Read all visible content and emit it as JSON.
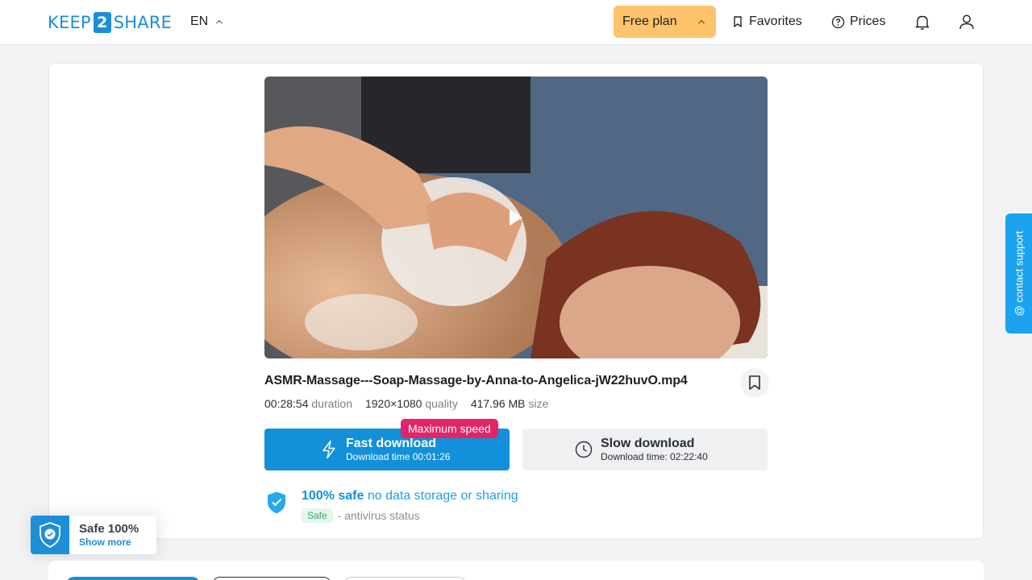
{
  "header": {
    "logo_left": "KEEP",
    "logo_mid": "2",
    "logo_right": "SHARE",
    "language": "EN",
    "free_plan": "Free plan",
    "favorites": "Favorites",
    "prices": "Prices"
  },
  "file": {
    "name": "ASMR-Massage---Soap-Massage-by-Anna-to-Angelica-jW22huvO.mp4",
    "duration_value": "00:28:54",
    "duration_label": "duration",
    "quality_value": "1920×1080",
    "quality_label": "quality",
    "size_value": "417.96 MB",
    "size_label": "size"
  },
  "download": {
    "badge": "Maximum speed",
    "fast_title": "Fast download",
    "fast_sub": "Download time 00:01:26",
    "slow_title": "Slow download",
    "slow_sub": "Download time: 02:22:40"
  },
  "safety": {
    "strong": "100% safe",
    "rest": "no data storage or sharing",
    "badge": "Safe",
    "status": "- antivirus status"
  },
  "support": {
    "label": "@ contact support"
  },
  "safe_widget": {
    "title": "Safe 100%",
    "more": "Show more"
  },
  "colors": {
    "accent": "#1290d9",
    "plan": "#fdc46b",
    "badge": "#e32467",
    "support": "#1ba3ef"
  },
  "icons": [
    "chevron-up-icon",
    "bookmark-icon",
    "question-circle-icon",
    "bell-icon",
    "user-icon",
    "play-icon",
    "lightning-icon",
    "clock-icon",
    "shield-check-icon"
  ]
}
